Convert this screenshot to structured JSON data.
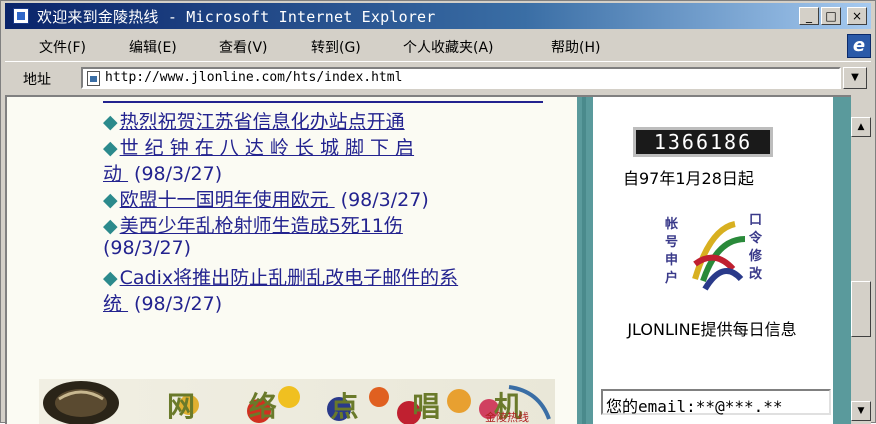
{
  "window": {
    "title": "欢迎来到金陵热线 - Microsoft Internet Explorer",
    "controls": {
      "minimize": "_",
      "maximize": "□",
      "close": "×"
    }
  },
  "menubar": {
    "items": [
      "文件(F)",
      "编辑(E)",
      "查看(V)",
      "转到(G)",
      "个人收藏夹(A)",
      "帮助(H)"
    ]
  },
  "address": {
    "label": "地址",
    "url": "http://www.jlonline.com/hts/index.html"
  },
  "news": [
    {
      "text": "热烈祝贺江苏省信息化办站点开通",
      "date": ""
    },
    {
      "text": "世 纪 钟 在 八 达 岭 长 城 脚 下 启",
      "date": ""
    },
    {
      "text": "动 ",
      "date": "(98/3/27)"
    },
    {
      "text": "欧盟十一国明年使用欧元 ",
      "date": "(98/3/27)"
    },
    {
      "text": "美西少年乱枪射师生造成5死11伤",
      "date": ""
    },
    {
      "text": "",
      "date": "(98/3/27)"
    },
    {
      "text": "Cadix将推出防止乱删乱改电子邮件的系",
      "date": ""
    },
    {
      "text": "统 ",
      "date": "(98/3/27)"
    }
  ],
  "sidebar": {
    "counter": "1366186",
    "since": "自97年1月28日起",
    "logo_chars": [
      "帐",
      "号",
      "申",
      "户",
      "口",
      "令",
      "修",
      "改"
    ],
    "provides": "JLONLINE提供每日信息",
    "email": "您的email:**@***.**"
  },
  "banner": {
    "text": "网 络 点 唱 机",
    "tag": "金陵热线"
  },
  "colors": {
    "link": "#23238f",
    "teal": "#5a9a9c",
    "titlebar": "#0a246a"
  }
}
